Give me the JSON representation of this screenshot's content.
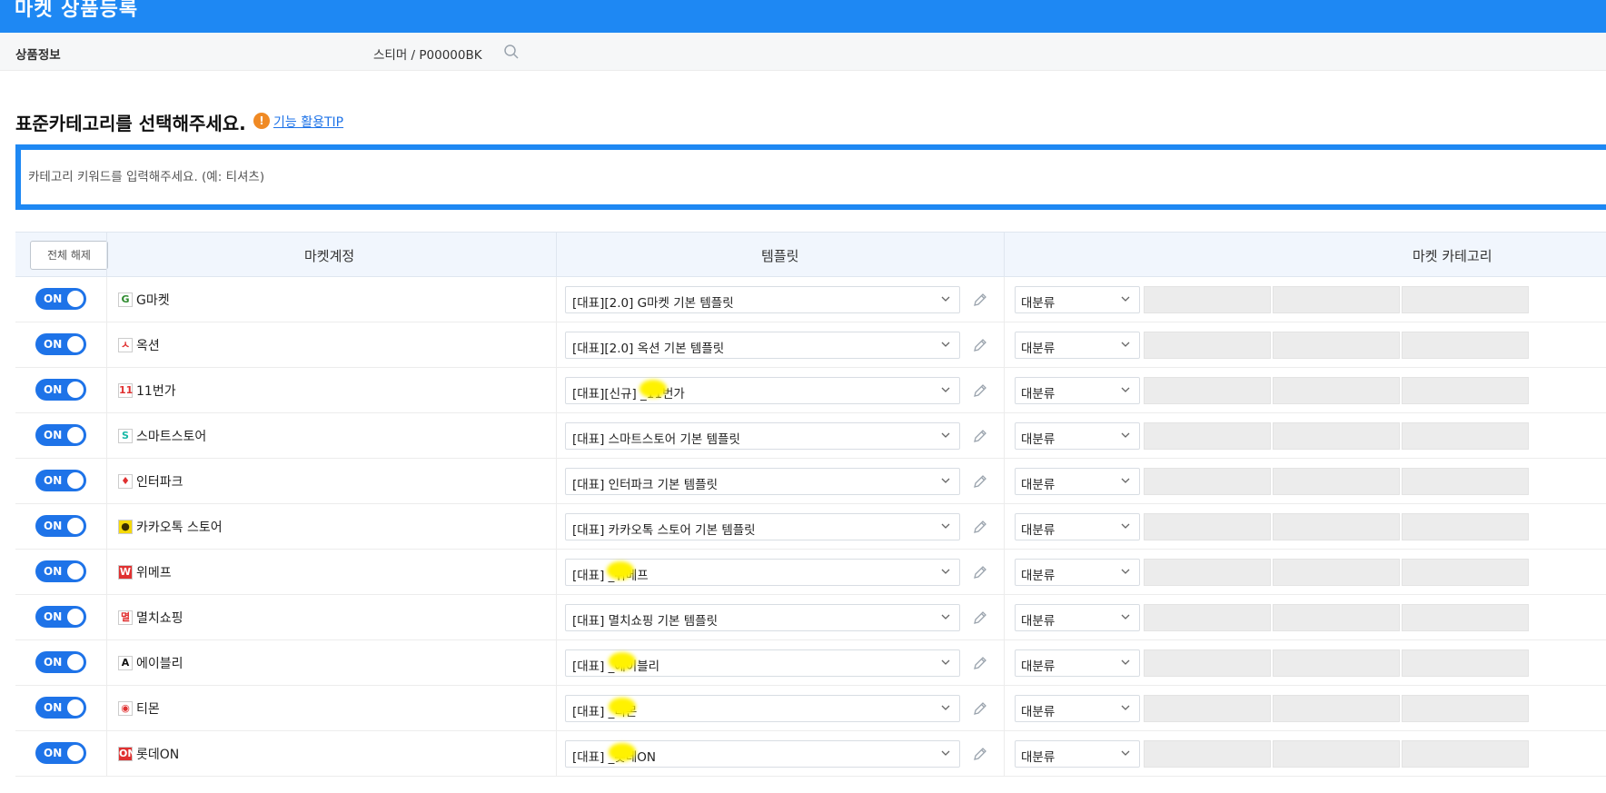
{
  "header": {
    "title": "마켓 상품등록"
  },
  "product": {
    "label": "상품정보",
    "value": "스티머 / P00000BK"
  },
  "category": {
    "heading": "표준카테고리를 선택해주세요.",
    "tip_icon": "!",
    "tip_link": "기능 활용TIP",
    "keyword_placeholder": "카테고리 키워드를 입력해주세요. (예: 티셔츠)"
  },
  "table": {
    "unselect_all": "전체 해제",
    "columns": {
      "account": "마켓계정",
      "template": "템플릿",
      "category": "마켓 카테고리"
    },
    "toggle_label": "ON",
    "category_placeholder": "대분류",
    "rows": [
      {
        "icon": "G",
        "icon_color": "#2e8b2e",
        "market": "G마켓",
        "template": "[대표][2.0] G마켓 기본 템플릿",
        "redacted": false
      },
      {
        "icon": "ㅅ",
        "icon_color": "#e03131",
        "market": "옥션",
        "template": "[대표][2.0] 옥션 기본 템플릿",
        "redacted": false
      },
      {
        "icon": "11",
        "icon_color": "#e03131",
        "market": "11번가",
        "template": "[대표][신규]       _11번가",
        "redacted": true
      },
      {
        "icon": "S",
        "icon_color": "#16b8a6",
        "market": "스마트스토어",
        "template": "[대표] 스마트스토어 기본 템플릿",
        "redacted": false
      },
      {
        "icon": "♦",
        "icon_color": "#e03131",
        "market": "인터파크",
        "template": "[대표] 인터파크 기본 템플릿",
        "redacted": false
      },
      {
        "icon": "●",
        "icon_color": "#3a2e00",
        "market": "카카오톡 스토어",
        "template": "[대표] 카카오톡 스토어 기본 템플릿",
        "redacted": false
      },
      {
        "icon": "W",
        "icon_color": "#ffffff",
        "market": "위메프",
        "template": "[대표]        _위메프",
        "redacted": true
      },
      {
        "icon": "멸",
        "icon_color": "#e03131",
        "market": "멸치쇼핑",
        "template": "[대표] 멸치쇼핑 기본 템플릿",
        "redacted": false
      },
      {
        "icon": "A",
        "icon_color": "#111111",
        "market": "에이블리",
        "template": "[대표]        _에이블리",
        "redacted": true
      },
      {
        "icon": "◉",
        "icon_color": "#e03131",
        "market": "티몬",
        "template": "[대표]        _티몬",
        "redacted": true
      },
      {
        "icon": "ON",
        "icon_color": "#ffffff",
        "market": "롯데ON",
        "template": "[대표]        _롯데ON",
        "redacted": true
      }
    ]
  },
  "colors": {
    "brand": "#1e88f3",
    "toggle_on": "#1e73e8",
    "tip": "#f08a24"
  }
}
